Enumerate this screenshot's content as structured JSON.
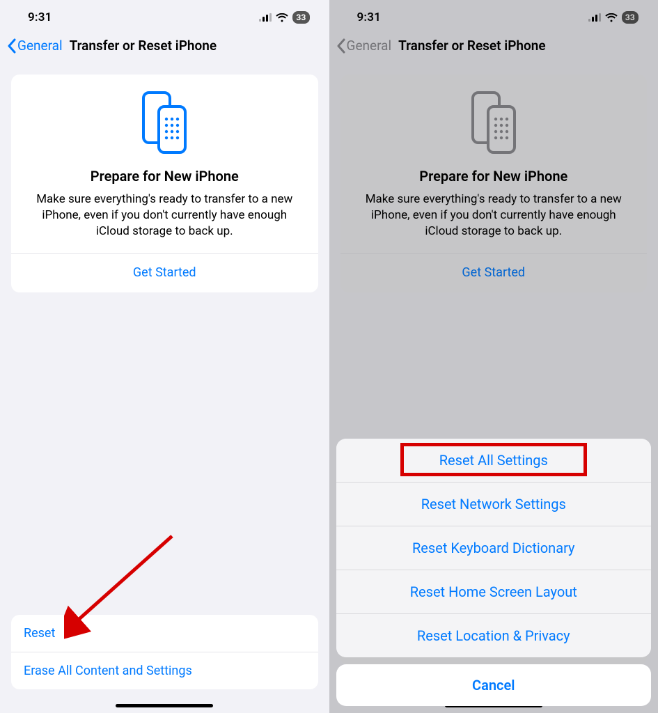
{
  "status": {
    "time": "9:31",
    "battery": "33"
  },
  "nav": {
    "back": "General",
    "title": "Transfer or Reset iPhone"
  },
  "card": {
    "title": "Prepare for New iPhone",
    "desc": "Make sure everything's ready to transfer to a new iPhone, even if you don't currently have enough iCloud storage to back up.",
    "action": "Get Started"
  },
  "bottom": {
    "reset": "Reset",
    "erase": "Erase All Content and Settings"
  },
  "sheet": {
    "options": [
      "Reset All Settings",
      "Reset Network Settings",
      "Reset Keyboard Dictionary",
      "Reset Home Screen Layout",
      "Reset Location & Privacy"
    ],
    "cancel": "Cancel"
  },
  "icon_color": {
    "active": "#007aff",
    "inactive": "#8e8e93"
  }
}
